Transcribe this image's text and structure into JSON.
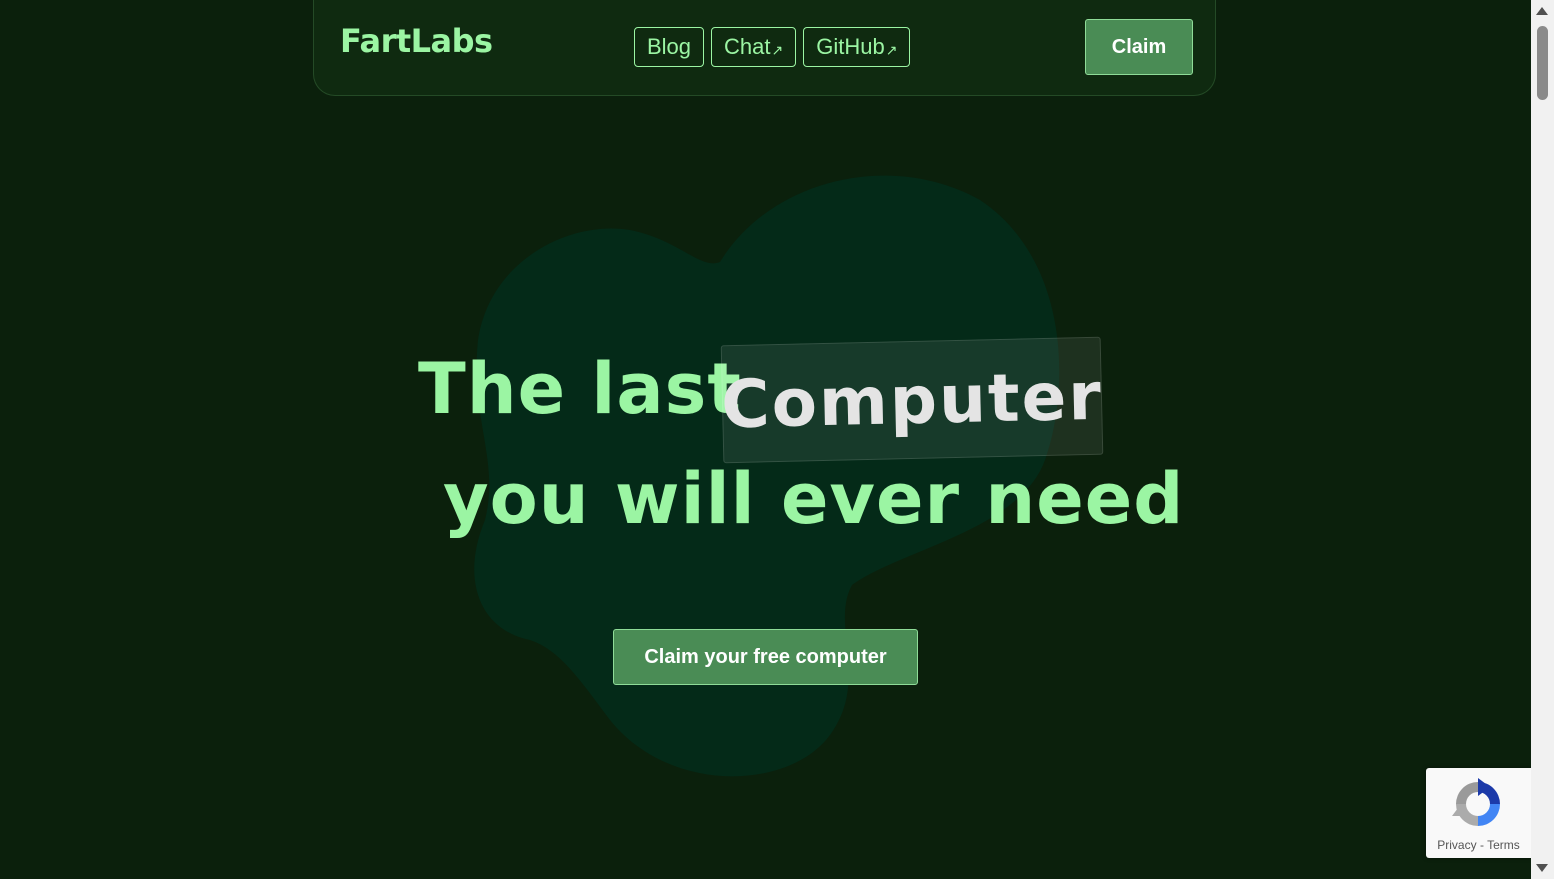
{
  "header": {
    "logo": "FartLabs",
    "nav": [
      {
        "label": "Blog",
        "external": false
      },
      {
        "label": "Chat",
        "external": true,
        "icon": "↗"
      },
      {
        "label": "GitHub",
        "external": true,
        "icon": "↗"
      }
    ],
    "claim_label": "Claim"
  },
  "hero": {
    "line1_prefix": "The last",
    "highlight_word": "Computer",
    "line2": "you will ever need",
    "cta_label": "Claim your free computer"
  },
  "recaptcha": {
    "privacy_label": "Privacy",
    "separator": "-",
    "terms_label": "Terms"
  },
  "colors": {
    "background": "#0b200c",
    "accent": "#9bf5a3",
    "button": "#4a8c55",
    "blob": "#042a18"
  }
}
